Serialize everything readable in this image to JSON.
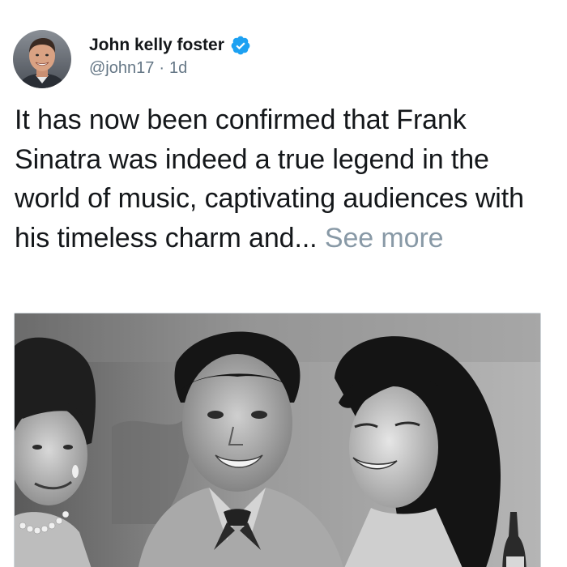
{
  "author": {
    "display_name": "John kelly foster",
    "handle": "@john17",
    "separator": "·",
    "time_ago": "1d",
    "verified": true
  },
  "tweet": {
    "text": "It has now been confirmed that Frank Sinatra was indeed a true legend in the world of music, captivating audiences with his timeless charm and...",
    "see_more_label": "See more"
  },
  "colors": {
    "verified_badge": "#1da1f2",
    "secondary_text": "#657786",
    "see_more": "#8899a6",
    "primary_text": "#14171a"
  },
  "icons": {
    "verified": "verified-badge-icon"
  }
}
